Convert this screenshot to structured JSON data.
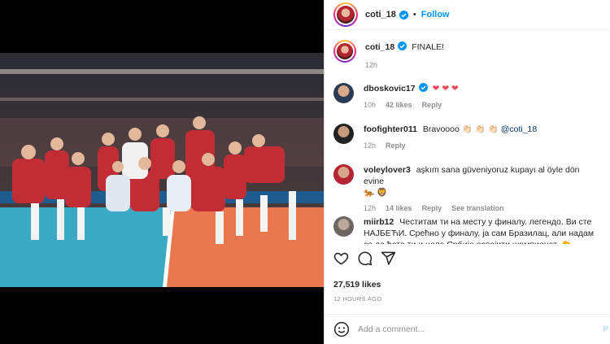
{
  "header": {
    "username": "coti_18",
    "separator": "•",
    "follow_label": "Follow"
  },
  "caption": {
    "username": "coti_18",
    "text": "FINALE!",
    "time": "12h"
  },
  "comments": [
    {
      "username": "dboskovic17",
      "verified": true,
      "text": "❤ ❤ ❤",
      "time": "10h",
      "likes": "42 likes",
      "reply": "Reply",
      "translate": ""
    },
    {
      "username": "foofighter011",
      "verified": false,
      "text": "Bravoooo 👏🏻 👏🏻 👏🏻",
      "mention": "@coti_18",
      "time": "12h",
      "reply": "Reply"
    },
    {
      "username": "voleylover3",
      "verified": false,
      "text": "aşkım sana güveniyoruz kupayı al öyle dön evine",
      "emoji": "🐅 🦁",
      "time": "12h",
      "likes": "14 likes",
      "reply": "Reply",
      "translate": "See translation"
    },
    {
      "username": "miirb12",
      "verified": false,
      "text": "Честитам ти на месту у финалу. легендо. Ви сте НАЈБЕЋИ. Срећно у финалу, ја сам Бразилац, али надам се да ћете ти и цела Србија освојити шампионат. 👏"
    }
  ],
  "footer": {
    "likes": "27,519 likes",
    "time": "12 HOURS AGO",
    "comment_placeholder": "Add a comment...",
    "post_label": "P"
  },
  "colors": {
    "accent": "#0095f6",
    "heart": "#ed4956",
    "court_blue": "#3aa9c4",
    "court_orange": "#e9784e"
  },
  "icons": [
    "verified-icon",
    "heart-icon",
    "comment-icon",
    "share-icon",
    "emoji-icon"
  ]
}
